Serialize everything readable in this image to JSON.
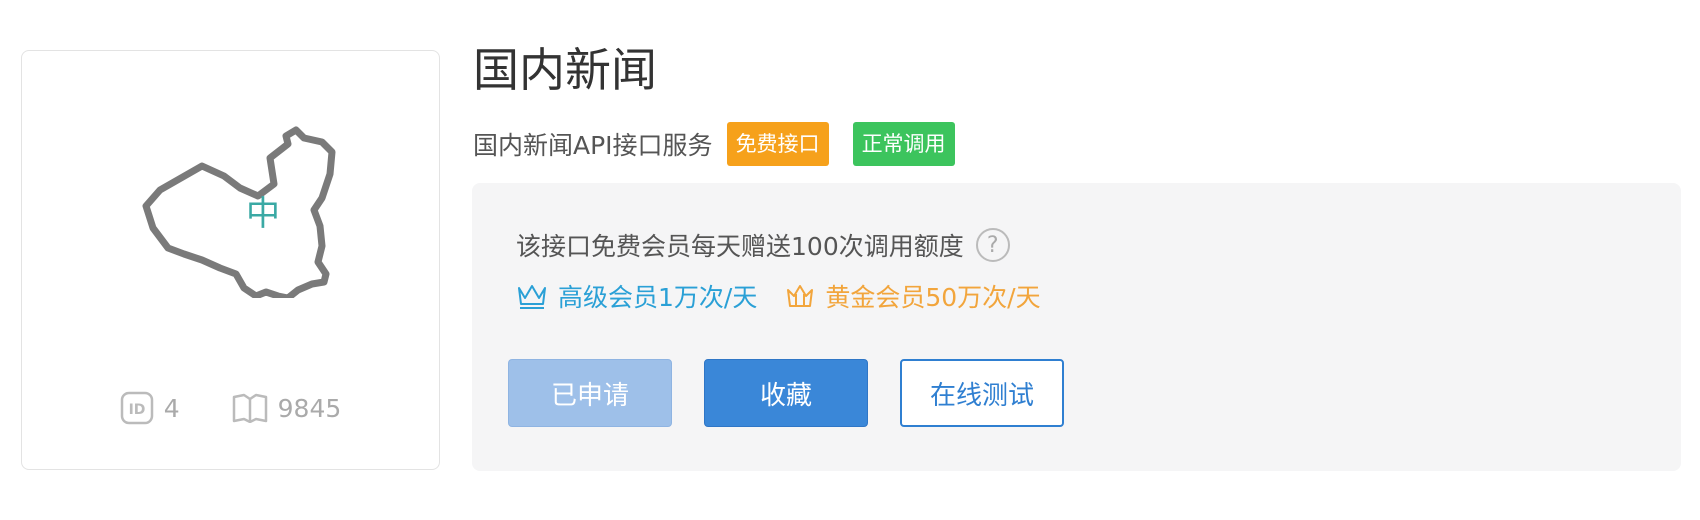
{
  "card": {
    "map_char": "中",
    "id_value": "4",
    "views_value": "9845"
  },
  "header": {
    "title": "国内新闻",
    "subtitle": "国内新闻API接口服务",
    "tag_free": "免费接口",
    "tag_status": "正常调用"
  },
  "panel": {
    "quota_text": "该接口免费会员每天赠送100次调用额度",
    "help_symbol": "?",
    "tier_premium": "高级会员1万次/天",
    "tier_gold": "黄金会员50万次/天"
  },
  "buttons": {
    "applied": "已申请",
    "favorite": "收藏",
    "online_test": "在线测试"
  },
  "colors": {
    "tag_free": "#f6a11b",
    "tag_status": "#3cc45d",
    "tier_premium": "#2aa0d6",
    "tier_gold": "#f2a53c",
    "primary": "#3a87d8"
  },
  "icons": {
    "map": "china-map-icon",
    "id": "id-badge-icon",
    "views": "book-icon",
    "help": "question-circle-icon",
    "premium": "crown-outline-icon",
    "gold": "crown-icon"
  }
}
